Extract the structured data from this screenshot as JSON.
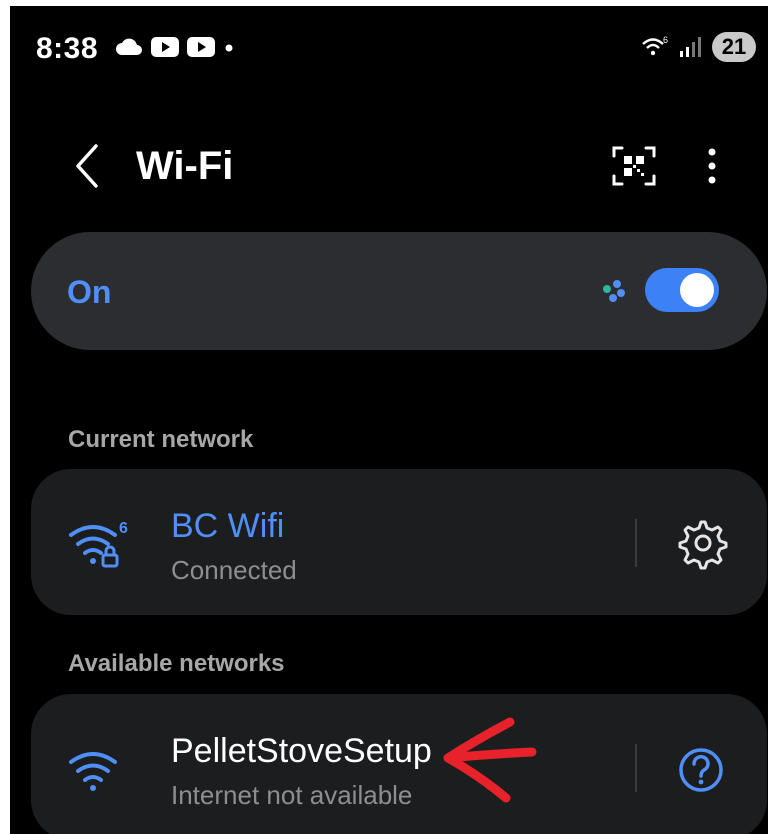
{
  "status_bar": {
    "time": "8:38",
    "wifi_badge": "6",
    "battery": "21"
  },
  "header": {
    "title": "Wi-Fi"
  },
  "wifi_toggle": {
    "label": "On",
    "state": "on"
  },
  "current_network": {
    "section_label": "Current network",
    "name": "BC Wifi",
    "status": "Connected",
    "wifi_badge": "6"
  },
  "available_networks": {
    "section_label": "Available networks",
    "items": [
      {
        "name": "PelletStoveSetup",
        "status": "Internet not available"
      }
    ]
  },
  "colors": {
    "accent": "#4f8ff7",
    "annotation": "#e8222a"
  }
}
